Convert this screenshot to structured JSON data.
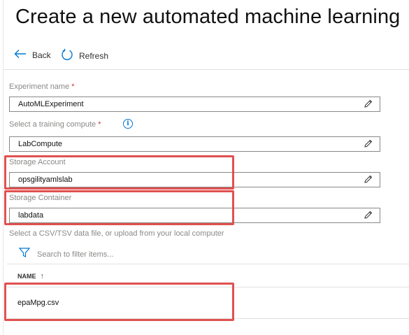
{
  "page": {
    "title": "Create a new automated machine learning"
  },
  "toolbar": {
    "back_label": "Back",
    "refresh_label": "Refresh"
  },
  "form": {
    "experiment": {
      "label": "Experiment name",
      "required_mark": "*",
      "value": "AutoMLExperiment"
    },
    "compute": {
      "label": "Select a training compute",
      "required_mark": "*",
      "value": "LabCompute"
    },
    "storage_account": {
      "label": "Storage Account",
      "value": "opsgilityamlslab"
    },
    "storage_container": {
      "label": "Storage Container",
      "value": "labdata"
    }
  },
  "file_section": {
    "prompt": "Select a CSV/TSV data file, or upload from your local computer",
    "filter_placeholder": "Search to filter items...",
    "column_header": "NAME",
    "sort_indicator": "↑",
    "files": [
      "epaMpg.csv"
    ]
  },
  "colors": {
    "accent": "#0078d4",
    "highlight": "#e05150"
  }
}
